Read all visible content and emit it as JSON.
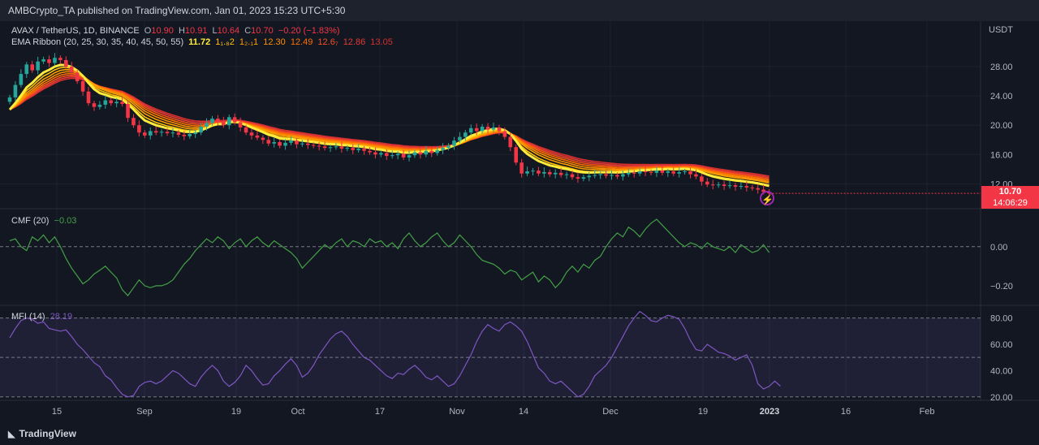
{
  "publisher_line": "AMBCrypto_TA published on TradingView.com, Jan 01, 2023 15:23 UTC+5:30",
  "brand": "TradingView",
  "currency_label": "USDT",
  "main_legend": {
    "symbol": "AVAX / TetherUS, 1D, BINANCE",
    "o_label": "O",
    "o_val": "10.90",
    "h_label": "H",
    "h_val": "10.91",
    "l_label": "L",
    "l_val": "10.64",
    "c_label": "C",
    "c_val": "10.70",
    "change": "−0.20 (−1.83%)"
  },
  "ema_legend": {
    "title": "EMA Ribbon (20, 25, 30, 35, 40, 45, 50, 55)",
    "values": [
      "11.72",
      "1₁.₈2",
      "1₂.₁1",
      "12.30",
      "12.49",
      "12.6₇",
      "12.86",
      "13.05"
    ]
  },
  "last_price": {
    "price": "10.70",
    "countdown": "14:06:29"
  },
  "colors": {
    "background": "#131722",
    "up": "#26a69a",
    "down": "#f23645",
    "cmf_line": "#43a047",
    "mfi_line": "#7e57c2",
    "ema": [
      "#ffeb3b",
      "#ffc107",
      "#ffa000",
      "#ff8f00",
      "#ff6f00",
      "#f4511e",
      "#e53935",
      "#d32f2f"
    ]
  },
  "chart_data": [
    {
      "type": "candlestick",
      "title": "AVAX / TetherUS, 1D, BINANCE",
      "ylabel": "USDT",
      "ylim": [
        8.6,
        31.0
      ],
      "yticks": [
        "28.00",
        "24.00",
        "20.00",
        "16.00",
        "12.00"
      ],
      "x_ticks": [
        "15",
        "Sep",
        "19",
        "Oct",
        "17",
        "Nov",
        "14",
        "Dec",
        "19",
        "2023",
        "16",
        "Feb"
      ],
      "close_series": [
        23.8,
        25.5,
        27.0,
        28.3,
        27.5,
        28.7,
        29.0,
        28.5,
        29.2,
        28.9,
        28.0,
        27.2,
        26.0,
        24.6,
        23.0,
        22.5,
        22.8,
        23.4,
        23.0,
        23.2,
        22.9,
        21.0,
        20.0,
        19.0,
        18.6,
        19.2,
        19.0,
        19.1,
        18.9,
        19.0,
        18.7,
        18.5,
        18.8,
        19.0,
        19.8,
        20.3,
        20.9,
        20.5,
        20.0,
        21.1,
        20.4,
        19.7,
        19.0,
        18.6,
        18.3,
        18.0,
        17.5,
        17.7,
        17.2,
        17.6,
        17.9,
        17.4,
        17.5,
        17.3,
        17.2,
        17.1,
        16.9,
        17.0,
        17.1,
        16.8,
        16.9,
        16.6,
        16.8,
        16.5,
        16.3,
        16.0,
        16.2,
        15.8,
        15.9,
        16.1,
        15.6,
        15.9,
        16.3,
        16.0,
        16.5,
        16.2,
        16.6,
        16.9,
        17.2,
        17.9,
        18.4,
        19.0,
        19.6,
        19.2,
        19.8,
        19.4,
        19.7,
        19.2,
        18.4,
        17.0,
        14.9,
        13.4,
        13.7,
        13.8,
        13.4,
        13.6,
        13.3,
        13.5,
        13.2,
        13.3,
        12.9,
        12.7,
        12.9,
        13.1,
        13.2,
        13.3,
        13.1,
        13.2,
        13.0,
        13.3,
        13.5,
        13.4,
        13.7,
        13.6,
        13.5,
        13.8,
        13.5,
        13.7,
        13.4,
        13.6,
        13.7,
        13.3,
        13.0,
        12.3,
        11.9,
        11.8,
        11.9,
        11.7,
        11.8,
        11.6,
        11.7,
        11.5,
        11.4,
        11.2,
        10.9,
        10.7
      ],
      "ema_values": [
        "11.72",
        "1₁.₈2",
        "1₂.₁1",
        "12.30",
        "12.49",
        "12.6₇",
        "12.86",
        "13.05"
      ],
      "last_close": 10.7
    },
    {
      "type": "line",
      "title": "CMF (20)",
      "last_value": "−0.03",
      "ylim": [
        -0.3,
        0.19
      ],
      "yticks": [
        "0.00",
        "−0.20"
      ],
      "series": [
        0.03,
        0.04,
        0.0,
        -0.02,
        0.05,
        0.03,
        0.06,
        0.02,
        0.05,
        0.0,
        -0.06,
        -0.11,
        -0.15,
        -0.19,
        -0.17,
        -0.14,
        -0.12,
        -0.1,
        -0.13,
        -0.16,
        -0.22,
        -0.25,
        -0.21,
        -0.17,
        -0.2,
        -0.21,
        -0.2,
        -0.2,
        -0.19,
        -0.17,
        -0.13,
        -0.09,
        -0.06,
        -0.02,
        0.01,
        0.04,
        0.02,
        0.05,
        0.03,
        -0.01,
        0.02,
        0.04,
        0.0,
        0.03,
        0.05,
        0.02,
        0.0,
        0.03,
        0.01,
        -0.01,
        -0.03,
        -0.06,
        -0.11,
        -0.08,
        -0.05,
        -0.02,
        0.01,
        -0.01,
        0.02,
        0.04,
        0.0,
        0.03,
        0.02,
        0.0,
        0.04,
        0.02,
        0.03,
        0.0,
        0.02,
        -0.01,
        0.04,
        0.07,
        0.03,
        0.0,
        0.02,
        0.05,
        0.07,
        0.03,
        0.0,
        0.02,
        0.06,
        0.03,
        0.0,
        -0.04,
        -0.07,
        -0.08,
        -0.09,
        -0.11,
        -0.14,
        -0.12,
        -0.13,
        -0.17,
        -0.15,
        -0.13,
        -0.18,
        -0.15,
        -0.17,
        -0.21,
        -0.18,
        -0.13,
        -0.1,
        -0.13,
        -0.09,
        -0.11,
        -0.07,
        -0.05,
        0.0,
        0.04,
        0.07,
        0.05,
        0.1,
        0.08,
        0.05,
        0.09,
        0.12,
        0.14,
        0.11,
        0.08,
        0.05,
        0.02,
        0.0,
        0.02,
        0.01,
        -0.01,
        0.02,
        0.0,
        -0.01,
        -0.02,
        0.0,
        -0.03,
        0.01,
        -0.01,
        -0.03,
        -0.02,
        0.01,
        -0.03
      ],
      "baseline": 0
    },
    {
      "type": "line",
      "title": "MFI (14)",
      "last_value": "28.19",
      "ylim": [
        18,
        89
      ],
      "yticks": [
        "80.00",
        "60.00",
        "40.00",
        "20.00"
      ],
      "bands": [
        20,
        50,
        80
      ],
      "series": [
        65,
        72,
        78,
        80,
        79,
        76,
        77,
        72,
        71,
        70,
        71,
        66,
        60,
        56,
        51,
        46,
        43,
        36,
        33,
        27,
        22,
        20,
        21,
        28,
        31,
        32,
        30,
        32,
        36,
        40,
        38,
        34,
        30,
        28,
        35,
        40,
        44,
        40,
        32,
        28,
        31,
        36,
        44,
        40,
        34,
        29,
        30,
        36,
        40,
        45,
        49,
        44,
        35,
        38,
        44,
        52,
        58,
        64,
        68,
        70,
        66,
        60,
        55,
        50,
        48,
        44,
        40,
        36,
        34,
        38,
        37,
        41,
        44,
        40,
        35,
        33,
        36,
        32,
        28,
        30,
        36,
        44,
        52,
        62,
        70,
        75,
        72,
        70,
        75,
        77,
        74,
        70,
        62,
        52,
        42,
        38,
        32,
        30,
        32,
        28,
        24,
        20,
        22,
        28,
        36,
        40,
        44,
        50,
        58,
        66,
        74,
        80,
        85,
        82,
        78,
        77,
        80,
        82,
        81,
        79,
        72,
        63,
        56,
        55,
        60,
        57,
        54,
        53,
        51,
        48,
        50,
        52,
        44,
        30,
        26,
        28,
        32,
        28.19
      ]
    }
  ]
}
